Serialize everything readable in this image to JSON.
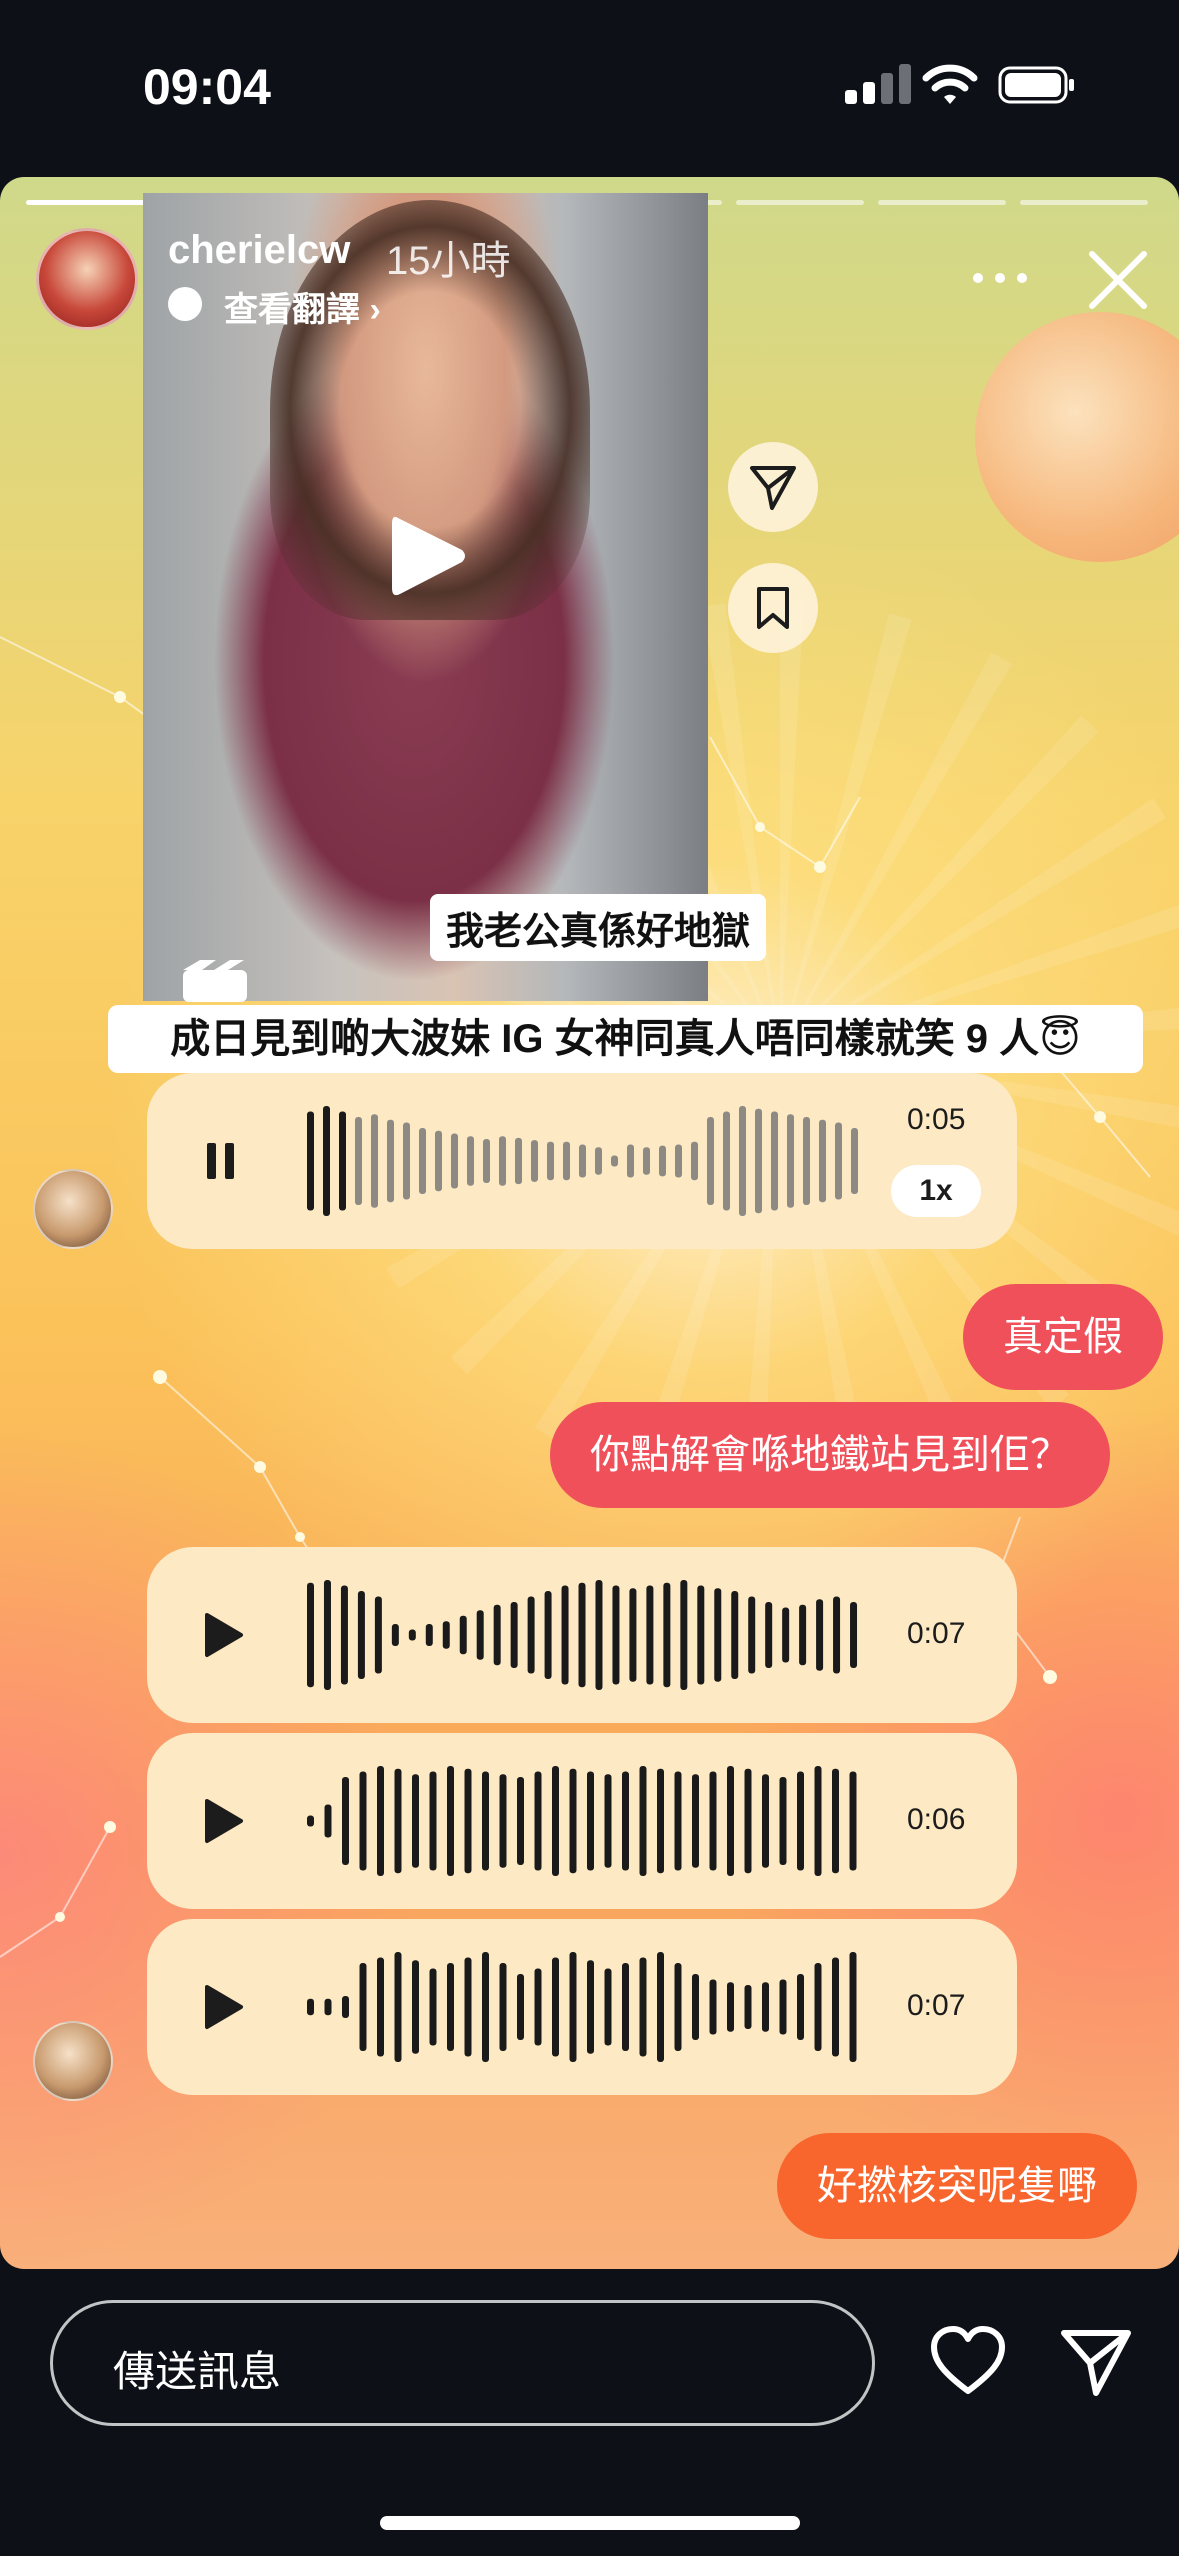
{
  "status_bar": {
    "time": "09:04"
  },
  "story": {
    "username": "cherielcw",
    "time_ago": "15小時",
    "translate_label": "查看翻譯 ›",
    "segments": 8,
    "segments_done": 3
  },
  "video": {
    "caption_top": "我老公真係好地獄",
    "caption_main": "成日見到啲大波妹 IG 女神同真人唔同樣就笑 9 人😇"
  },
  "chat": {
    "voice_messages": [
      {
        "duration": "0:05",
        "state": "playing",
        "speed": "1x"
      },
      {
        "duration": "0:07",
        "state": "paused"
      },
      {
        "duration": "0:06",
        "state": "paused"
      },
      {
        "duration": "0:07",
        "state": "paused"
      }
    ],
    "sent_messages": [
      {
        "text": "真定假"
      },
      {
        "text": "你點解會喺地鐵站見到佢？"
      },
      {
        "text": "好撚核突呢隻嘢"
      }
    ]
  },
  "composer": {
    "placeholder": "傳送訊息"
  },
  "icons": {
    "more": "more-icon",
    "close": "close-icon",
    "play": "play-icon",
    "share": "send-icon",
    "bookmark": "bookmark-icon",
    "pause": "pause-icon",
    "heart": "heart-icon",
    "send": "send-icon"
  },
  "colors": {
    "sent_bubble": "#f0505a",
    "sent_bubble_last": "#f8662e",
    "voice_bubble": "#fde9c3"
  }
}
